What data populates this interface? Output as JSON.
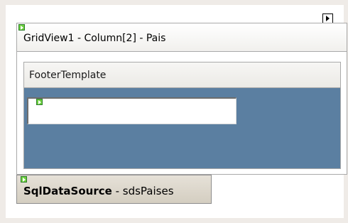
{
  "gridview": {
    "title": "GridView1 - Column[2] - Pais",
    "template_name": "FooterTemplate",
    "textbox_value": ""
  },
  "datasource": {
    "type": "SqlDataSource",
    "separator": " - ",
    "id": "sdsPaises"
  },
  "colors": {
    "template_background": "#5b7fa1",
    "designer_background": "#efebe7",
    "marker_green": "#6ccf3d"
  },
  "icons": {
    "smart_tag": "smart-tag-arrow-icon",
    "control_marker": "control-marker-icon"
  }
}
